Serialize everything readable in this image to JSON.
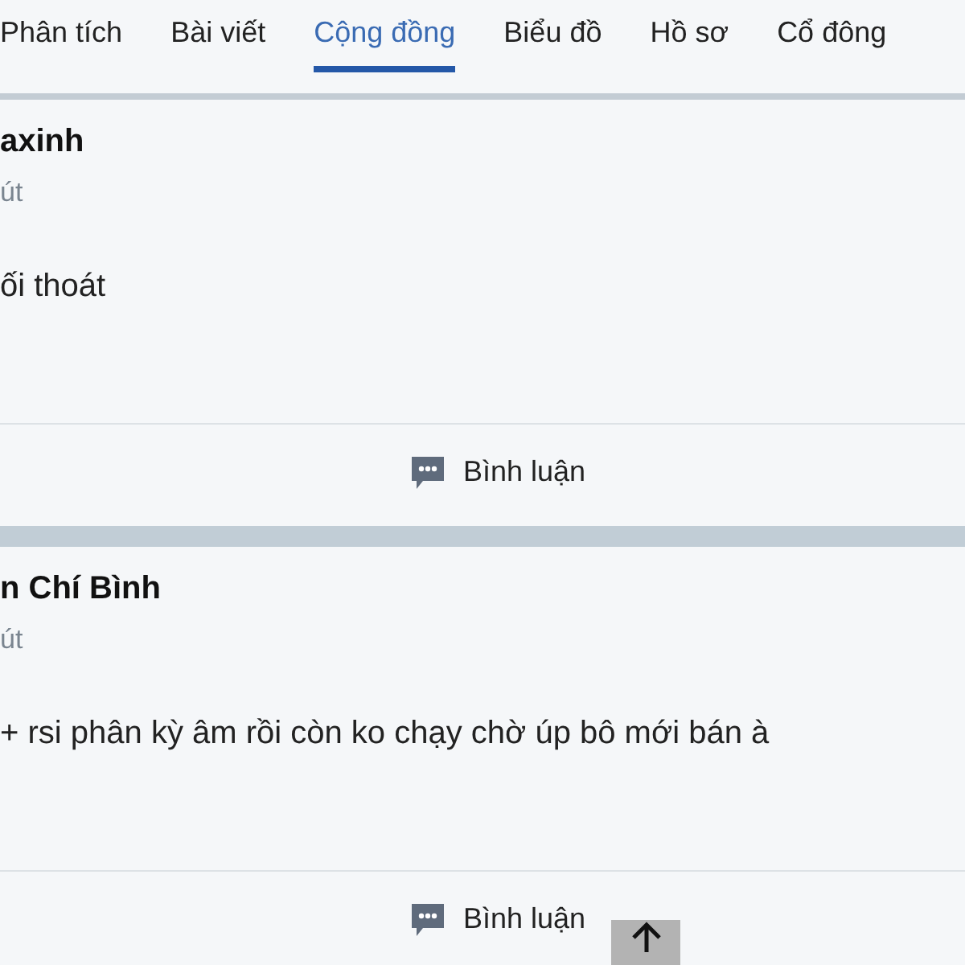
{
  "tabs": [
    {
      "label": "Phân tích",
      "selected": false
    },
    {
      "label": "Bài viết",
      "selected": false
    },
    {
      "label": "Cộng đồng",
      "selected": true
    },
    {
      "label": "Biểu đồ",
      "selected": false
    },
    {
      "label": "Hồ sơ",
      "selected": false
    },
    {
      "label": "Cổ đông",
      "selected": false
    }
  ],
  "posts": [
    {
      "author": "axinh",
      "time": "út",
      "body": "ối thoát",
      "comment": "Bình luận"
    },
    {
      "author": "n Chí Bình",
      "time": "út",
      "body": "+ rsi phân kỳ âm rồi còn ko chạy chờ úp bô mới bán à",
      "comment": "Bình luận"
    }
  ]
}
